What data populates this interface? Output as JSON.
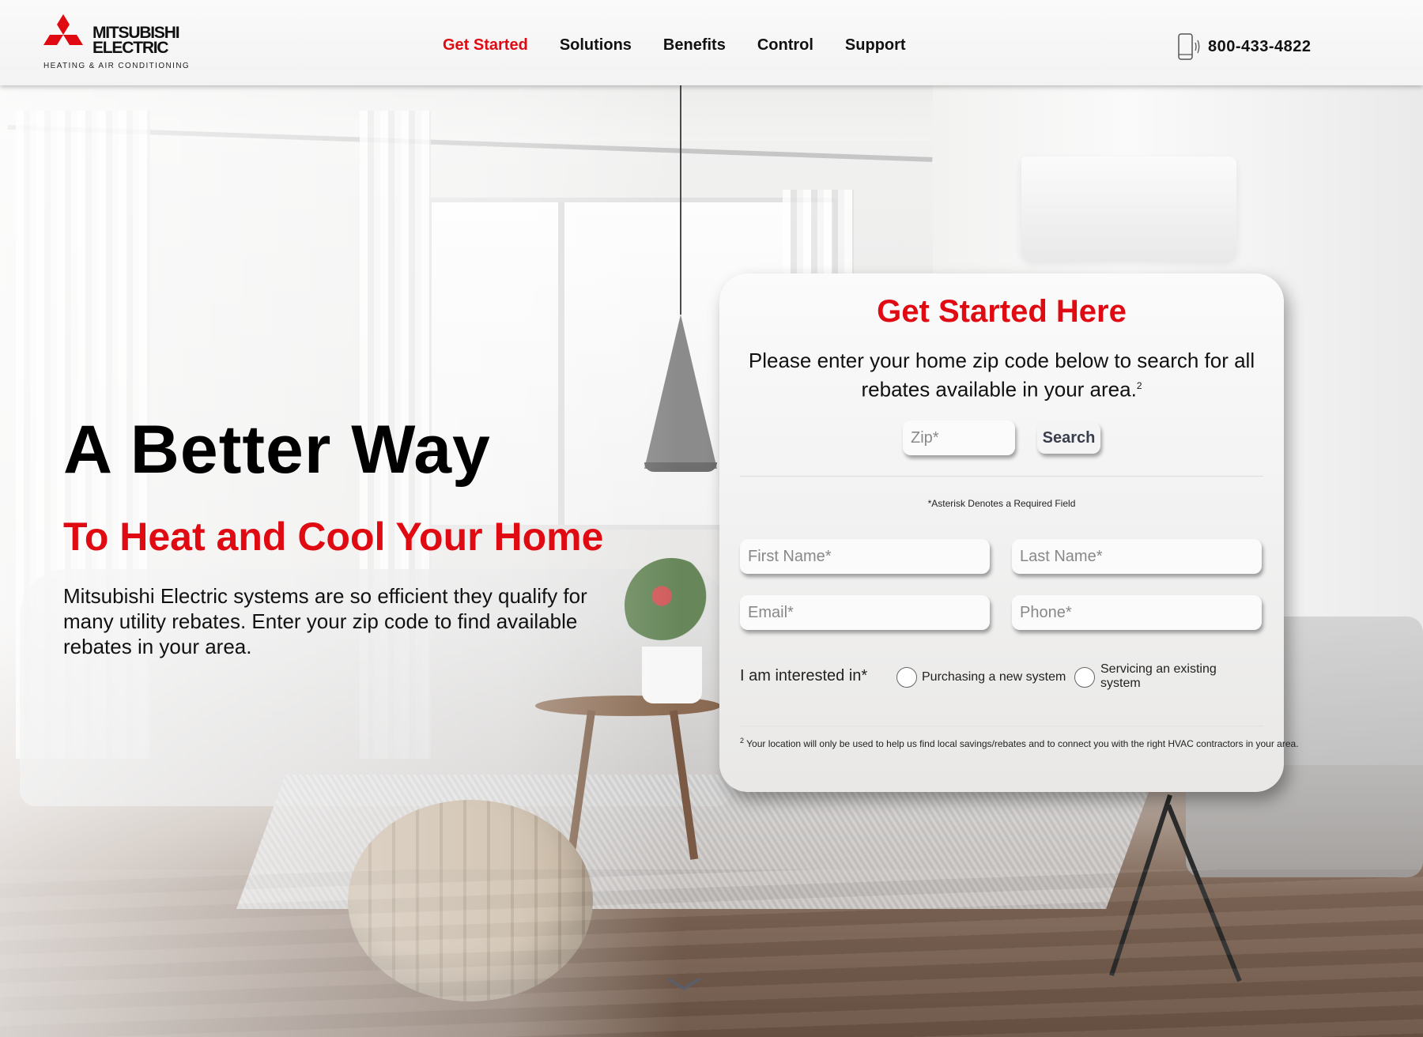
{
  "brand": {
    "name_line1": "MITSUBISHI",
    "name_line2": "ELECTRIC",
    "tagline": "HEATING & AIR CONDITIONING",
    "accent_color": "#e00b12"
  },
  "nav": {
    "items": [
      {
        "label": "Get Started",
        "active": true
      },
      {
        "label": "Solutions",
        "active": false
      },
      {
        "label": "Benefits",
        "active": false
      },
      {
        "label": "Control",
        "active": false
      },
      {
        "label": "Support",
        "active": false
      }
    ]
  },
  "contact": {
    "icon": "mobile-phone-icon",
    "phone": "800-433-4822"
  },
  "hero": {
    "title": "A Better Way",
    "subtitle": "To Heat and Cool Your Home",
    "body": "Mitsubishi Electric systems are so efficient they qualify for many utility rebates. Enter your zip code to find available rebates in your area."
  },
  "form": {
    "title": "Get Started Here",
    "intro": "Please enter your home zip code below to search for all rebates available in your area.",
    "intro_footnote_ref": "2",
    "zip": {
      "placeholder": "Zip*",
      "value": ""
    },
    "search_label": "Search",
    "required_note": "*Asterisk Denotes a Required Field",
    "fields": {
      "first_name": {
        "placeholder": "First Name*",
        "value": ""
      },
      "last_name": {
        "placeholder": "Last Name*",
        "value": ""
      },
      "email": {
        "placeholder": "Email*",
        "value": ""
      },
      "phone": {
        "placeholder": "Phone*",
        "value": ""
      }
    },
    "interest": {
      "label": "I am interested in*",
      "options": [
        {
          "label": "Purchasing a new system",
          "selected": false
        },
        {
          "label": "Servicing an existing system",
          "selected": false
        }
      ]
    },
    "footnote_number": "2",
    "footnote": "Your location will only be used to help us find local savings/rebates and to connect you with the right HVAC contractors in your area."
  },
  "scroll_hint": {
    "icon": "chevron-down-icon"
  }
}
